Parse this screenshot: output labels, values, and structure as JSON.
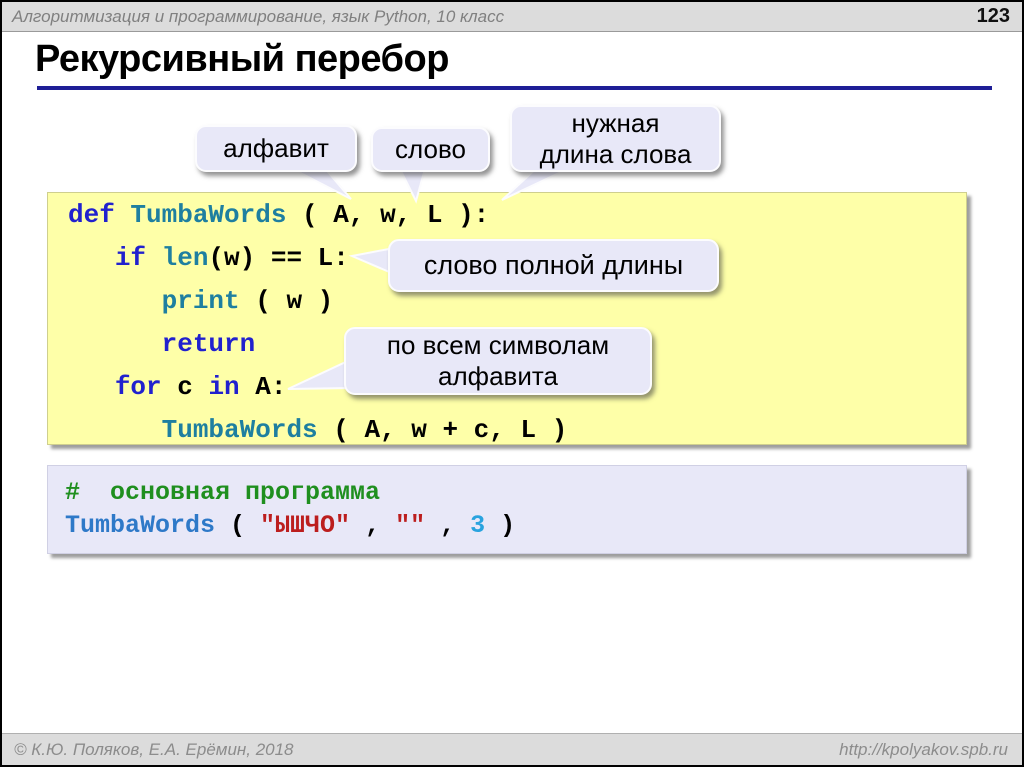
{
  "topbar": {
    "course_title": "Алгоритмизация и программирование, язык Python, 10 класс",
    "page_number": "123"
  },
  "title": "Рекурсивный перебор",
  "callouts": [
    {
      "name": "alphabet",
      "lines": [
        "алфавит"
      ]
    },
    {
      "name": "word",
      "lines": [
        "слово"
      ]
    },
    {
      "name": "word-length",
      "lines": [
        "нужная",
        "длина слова"
      ]
    },
    {
      "name": "full-word",
      "lines": [
        "слово полной длины"
      ]
    },
    {
      "name": "all-chars",
      "lines": [
        "по всем символам",
        "алфавита"
      ]
    }
  ],
  "code_blocks": [
    {
      "name": "recursive-function",
      "lines": [
        [
          {
            "t": "def ",
            "c": "kw"
          },
          {
            "t": "TumbaWords",
            "c": "fn"
          },
          {
            "t": " ( A, w, L ):",
            "c": "pl"
          }
        ],
        [
          {
            "t": "   ",
            "c": "pl"
          },
          {
            "t": "if ",
            "c": "kw"
          },
          {
            "t": "len",
            "c": "fn"
          },
          {
            "t": "(w) == L:",
            "c": "pl"
          }
        ],
        [
          {
            "t": "      ",
            "c": "pl"
          },
          {
            "t": "print",
            "c": "fn"
          },
          {
            "t": " ( w )",
            "c": "pl"
          }
        ],
        [
          {
            "t": "      ",
            "c": "pl"
          },
          {
            "t": "return",
            "c": "kw"
          }
        ],
        [
          {
            "t": "   ",
            "c": "pl"
          },
          {
            "t": "for",
            "c": "kw"
          },
          {
            "t": " c ",
            "c": "pl"
          },
          {
            "t": "in",
            "c": "kw"
          },
          {
            "t": " A:",
            "c": "pl"
          }
        ],
        [
          {
            "t": "      ",
            "c": "pl"
          },
          {
            "t": "TumbaWords",
            "c": "fn"
          },
          {
            "t": " ( A, w + c, L )",
            "c": "pl"
          }
        ]
      ]
    },
    {
      "name": "main-program",
      "lines": [
        [
          {
            "t": "#  основная программа",
            "c": "com"
          }
        ],
        [
          {
            "t": "TumbaWords",
            "c": "fncall"
          },
          {
            "t": " ( ",
            "c": "pl"
          },
          {
            "t": "\"ЫШЧО\"",
            "c": "str"
          },
          {
            "t": " , ",
            "c": "pl"
          },
          {
            "t": "\"\"",
            "c": "str"
          },
          {
            "t": " , ",
            "c": "pl"
          },
          {
            "t": "3",
            "c": "num"
          },
          {
            "t": " )",
            "c": "pl"
          }
        ]
      ]
    }
  ],
  "footer": {
    "copyright": "© К.Ю. Поляков, Е.А. Ерёмин, 2018",
    "url": "http://kpolyakov.spb.ru"
  },
  "colors": {
    "keyword": "#2121CE",
    "builtin": "#1E7FA0",
    "call": "#2E79C8",
    "string": "#BC1E1E",
    "number": "#29A3DF",
    "comment": "#1F8F1F",
    "code_default": "#000000",
    "title_underline": "#1E1E96",
    "block1_bg": "#FEFFA8",
    "block2_bg": "#E8E8F8",
    "bubble_bg": "#E8E8F8",
    "bar_bg": "#DCDCDC"
  }
}
